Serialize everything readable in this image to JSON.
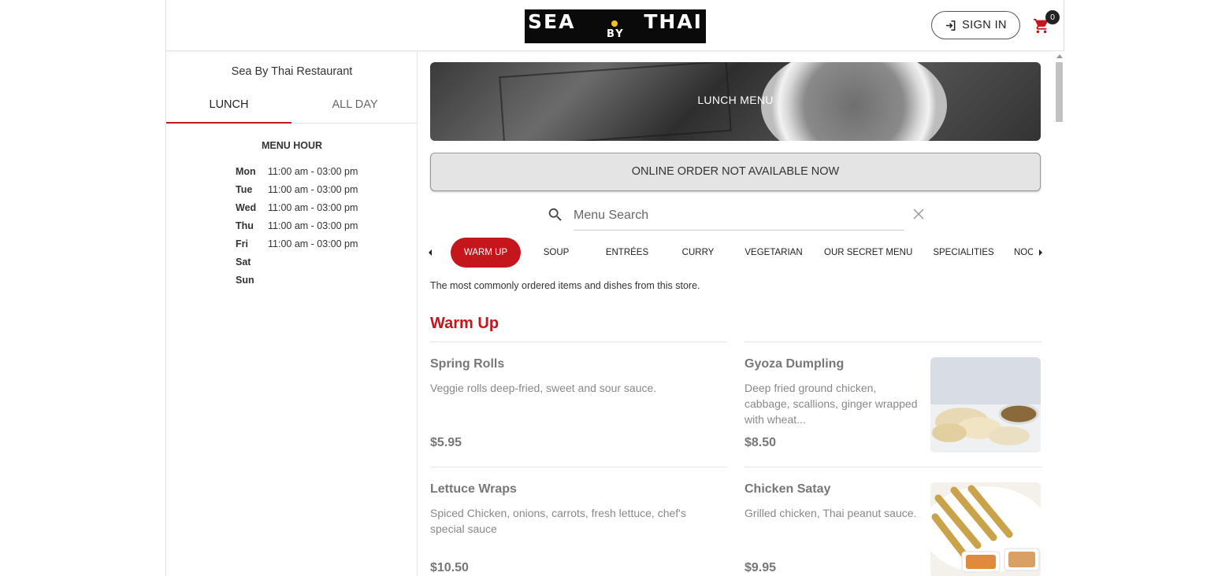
{
  "header": {
    "logo_text": {
      "left": "SEA",
      "right": "THAI",
      "by": "BY"
    },
    "signin_label": "SIGN IN",
    "cart_count": "0"
  },
  "sidebar": {
    "restaurant_name": "Sea By Thai Restaurant",
    "tabs": [
      {
        "label": "LUNCH",
        "active": true
      },
      {
        "label": "ALL DAY",
        "active": false
      }
    ],
    "menu_hour_title": "MENU HOUR",
    "hours": [
      {
        "day": "Mon",
        "time": "11:00 am - 03:00 pm"
      },
      {
        "day": "Tue",
        "time": "11:00 am - 03:00 pm"
      },
      {
        "day": "Wed",
        "time": "11:00 am - 03:00 pm"
      },
      {
        "day": "Thu",
        "time": "11:00 am - 03:00 pm"
      },
      {
        "day": "Fri",
        "time": "11:00 am - 03:00 pm"
      },
      {
        "day": "Sat",
        "time": ""
      },
      {
        "day": "Sun",
        "time": ""
      }
    ]
  },
  "main": {
    "banner_title": "LUNCH MENU",
    "order_status": "ONLINE ORDER NOT AVAILABLE NOW",
    "search": {
      "placeholder": "Menu Search",
      "value": ""
    },
    "categories": [
      {
        "label": "WARM UP",
        "active": true
      },
      {
        "label": "SOUP",
        "active": false
      },
      {
        "label": "ENTRÉES",
        "active": false
      },
      {
        "label": "CURRY",
        "active": false
      },
      {
        "label": "VEGETARIAN",
        "active": false
      },
      {
        "label": "OUR SECRET MENU",
        "active": false
      },
      {
        "label": "SPECIALITIES",
        "active": false
      },
      {
        "label": "NOODLES",
        "active": false
      }
    ],
    "popular_description": "The most commonly ordered items and dishes from this store.",
    "section_title": "Warm Up",
    "items": [
      {
        "name": "Spring Rolls",
        "description": "Veggie rolls deep-fried, sweet and sour sauce.",
        "price": "$5.95",
        "image": "none"
      },
      {
        "name": "Gyoza Dumpling",
        "description": "Deep fried ground chicken, cabbage, scallions, ginger wrapped with wheat...",
        "price": "$8.50",
        "image": "dumplings-photo"
      },
      {
        "name": "Lettuce Wraps",
        "description": "Spiced Chicken, onions, carrots, fresh lettuce, chef's special sauce",
        "price": "$10.50",
        "image": "none"
      },
      {
        "name": "Chicken Satay",
        "description": "Grilled chicken, Thai peanut sauce.",
        "price": "$9.95",
        "image": "satay-photo"
      }
    ]
  },
  "colors": {
    "accent": "#c4161c",
    "logo_bg": "#0a0a0a",
    "logo_dot": "#f3c318",
    "status_bg": "#e4e4e4"
  },
  "icons": [
    "sign-in-icon",
    "cart-icon",
    "search-icon",
    "close-icon",
    "arrow-left-icon",
    "arrow-right-icon"
  ]
}
